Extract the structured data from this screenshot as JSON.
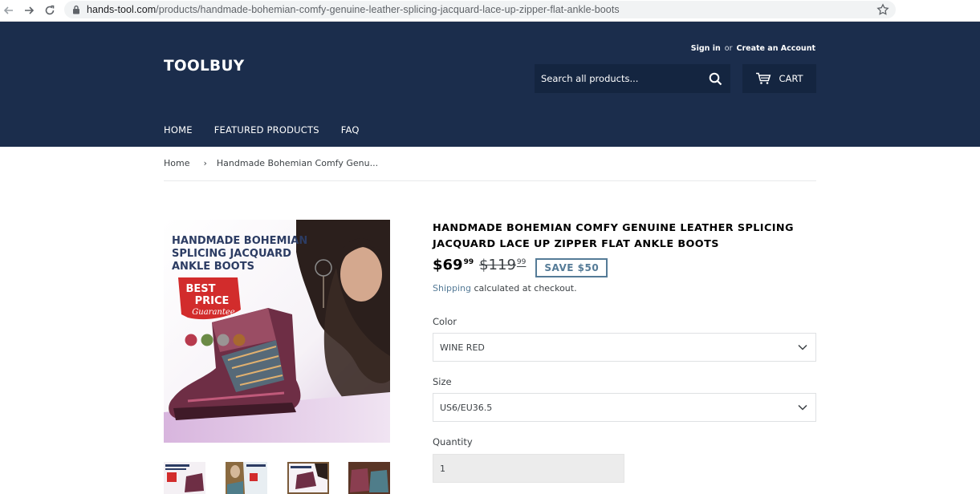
{
  "browser": {
    "url_host": "hands-tool.com",
    "url_path": "/products/handmade-bohemian-comfy-genuine-leather-splicing-jacquard-lace-up-zipper-flat-ankle-boots"
  },
  "header": {
    "logo": "TOOLBUY",
    "sign_in": "Sign in",
    "or": "or",
    "create_account": "Create an Account",
    "search_placeholder": "Search all products...",
    "cart_label": "CART",
    "nav": [
      "HOME",
      "FEATURED PRODUCTS",
      "FAQ"
    ]
  },
  "breadcrumb": {
    "home": "Home",
    "separator": "›",
    "current": "Handmade Bohemian Comfy Genu..."
  },
  "product": {
    "image_text": {
      "line1": "HANDMADE BOHEMIAN",
      "line2": "SPLICING JACQUARD",
      "line3": "ANKLE BOOTS",
      "badge_line1": "BEST",
      "badge_line2": "PRICE",
      "badge_line3": "Guarantee"
    },
    "swatch_colors": [
      "#b73a4d",
      "#6b8a46",
      "#9a9494",
      "#a8682f"
    ],
    "title": "HANDMADE BOHEMIAN COMFY GENUINE LEATHER SPLICING JACQUARD LACE UP ZIPPER FLAT ANKLE BOOTS",
    "price_main": "$69",
    "price_cents": "99",
    "compare_main": "$119",
    "compare_cents": "99",
    "save_badge": "SAVE $50",
    "shipping_link": "Shipping",
    "shipping_text": " calculated at checkout.",
    "color_label": "Color",
    "color_value": "WINE RED",
    "size_label": "Size",
    "size_value": "US6/EU36.5",
    "quantity_label": "Quantity",
    "quantity_value": "1"
  },
  "colors": {
    "header_bg": "#1b2d4c",
    "header_control_bg": "#142540",
    "accent": "#557b97",
    "text": "#3d4246"
  }
}
